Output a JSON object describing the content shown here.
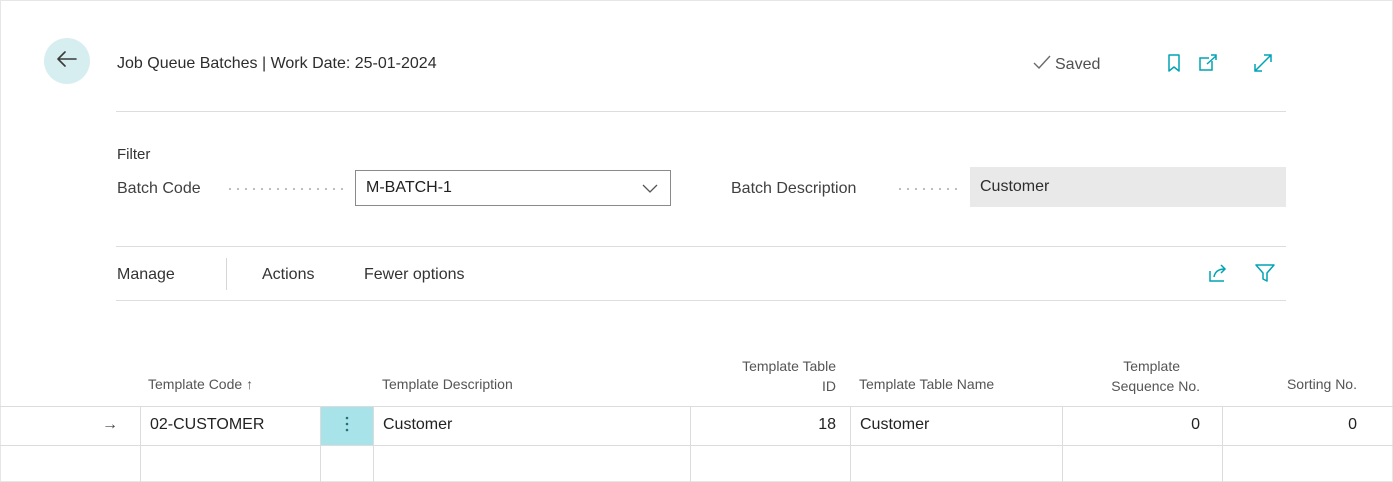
{
  "header": {
    "title": "Job Queue Batches | Work Date: 25-01-2024",
    "saved_label": "Saved"
  },
  "filter": {
    "heading": "Filter",
    "batch_code_label": "Batch Code",
    "batch_code_value": "M-BATCH-1",
    "batch_description_label": "Batch Description",
    "batch_description_value": "Customer"
  },
  "actionbar": {
    "manage": "Manage",
    "actions": "Actions",
    "fewer_options": "Fewer options"
  },
  "table": {
    "columns": {
      "template_code": "Template Code",
      "sort_arrow": "↑",
      "template_description": "Template Description",
      "template_table_id_line1": "Template Table",
      "template_table_id_line2": "ID",
      "template_table_name": "Template Table Name",
      "template_sequence_line1": "Template",
      "template_sequence_line2": "Sequence No.",
      "sorting_no": "Sorting No."
    },
    "rows": [
      {
        "indicator": "→",
        "template_code": "02-CUSTOMER",
        "template_description": "Customer",
        "template_table_id": "18",
        "template_table_name": "Customer",
        "template_sequence_no": "0",
        "sorting_no": "0"
      }
    ]
  },
  "icons": {
    "back": "back-arrow-icon",
    "saved": "checkmark-icon",
    "bookmark": "bookmark-icon",
    "open_new_window": "open-new-window-icon",
    "expand": "expand-icon",
    "dropdown": "chevron-down-icon",
    "share": "share-icon",
    "filter": "filter-icon",
    "row_menu": "more-vertical-icon"
  },
  "colors": {
    "accent": "#00a3b4",
    "back_button_bg": "#d7eef1",
    "row_menu_bg": "#a9e3ea",
    "readonly_bg": "#e9e9e9"
  }
}
